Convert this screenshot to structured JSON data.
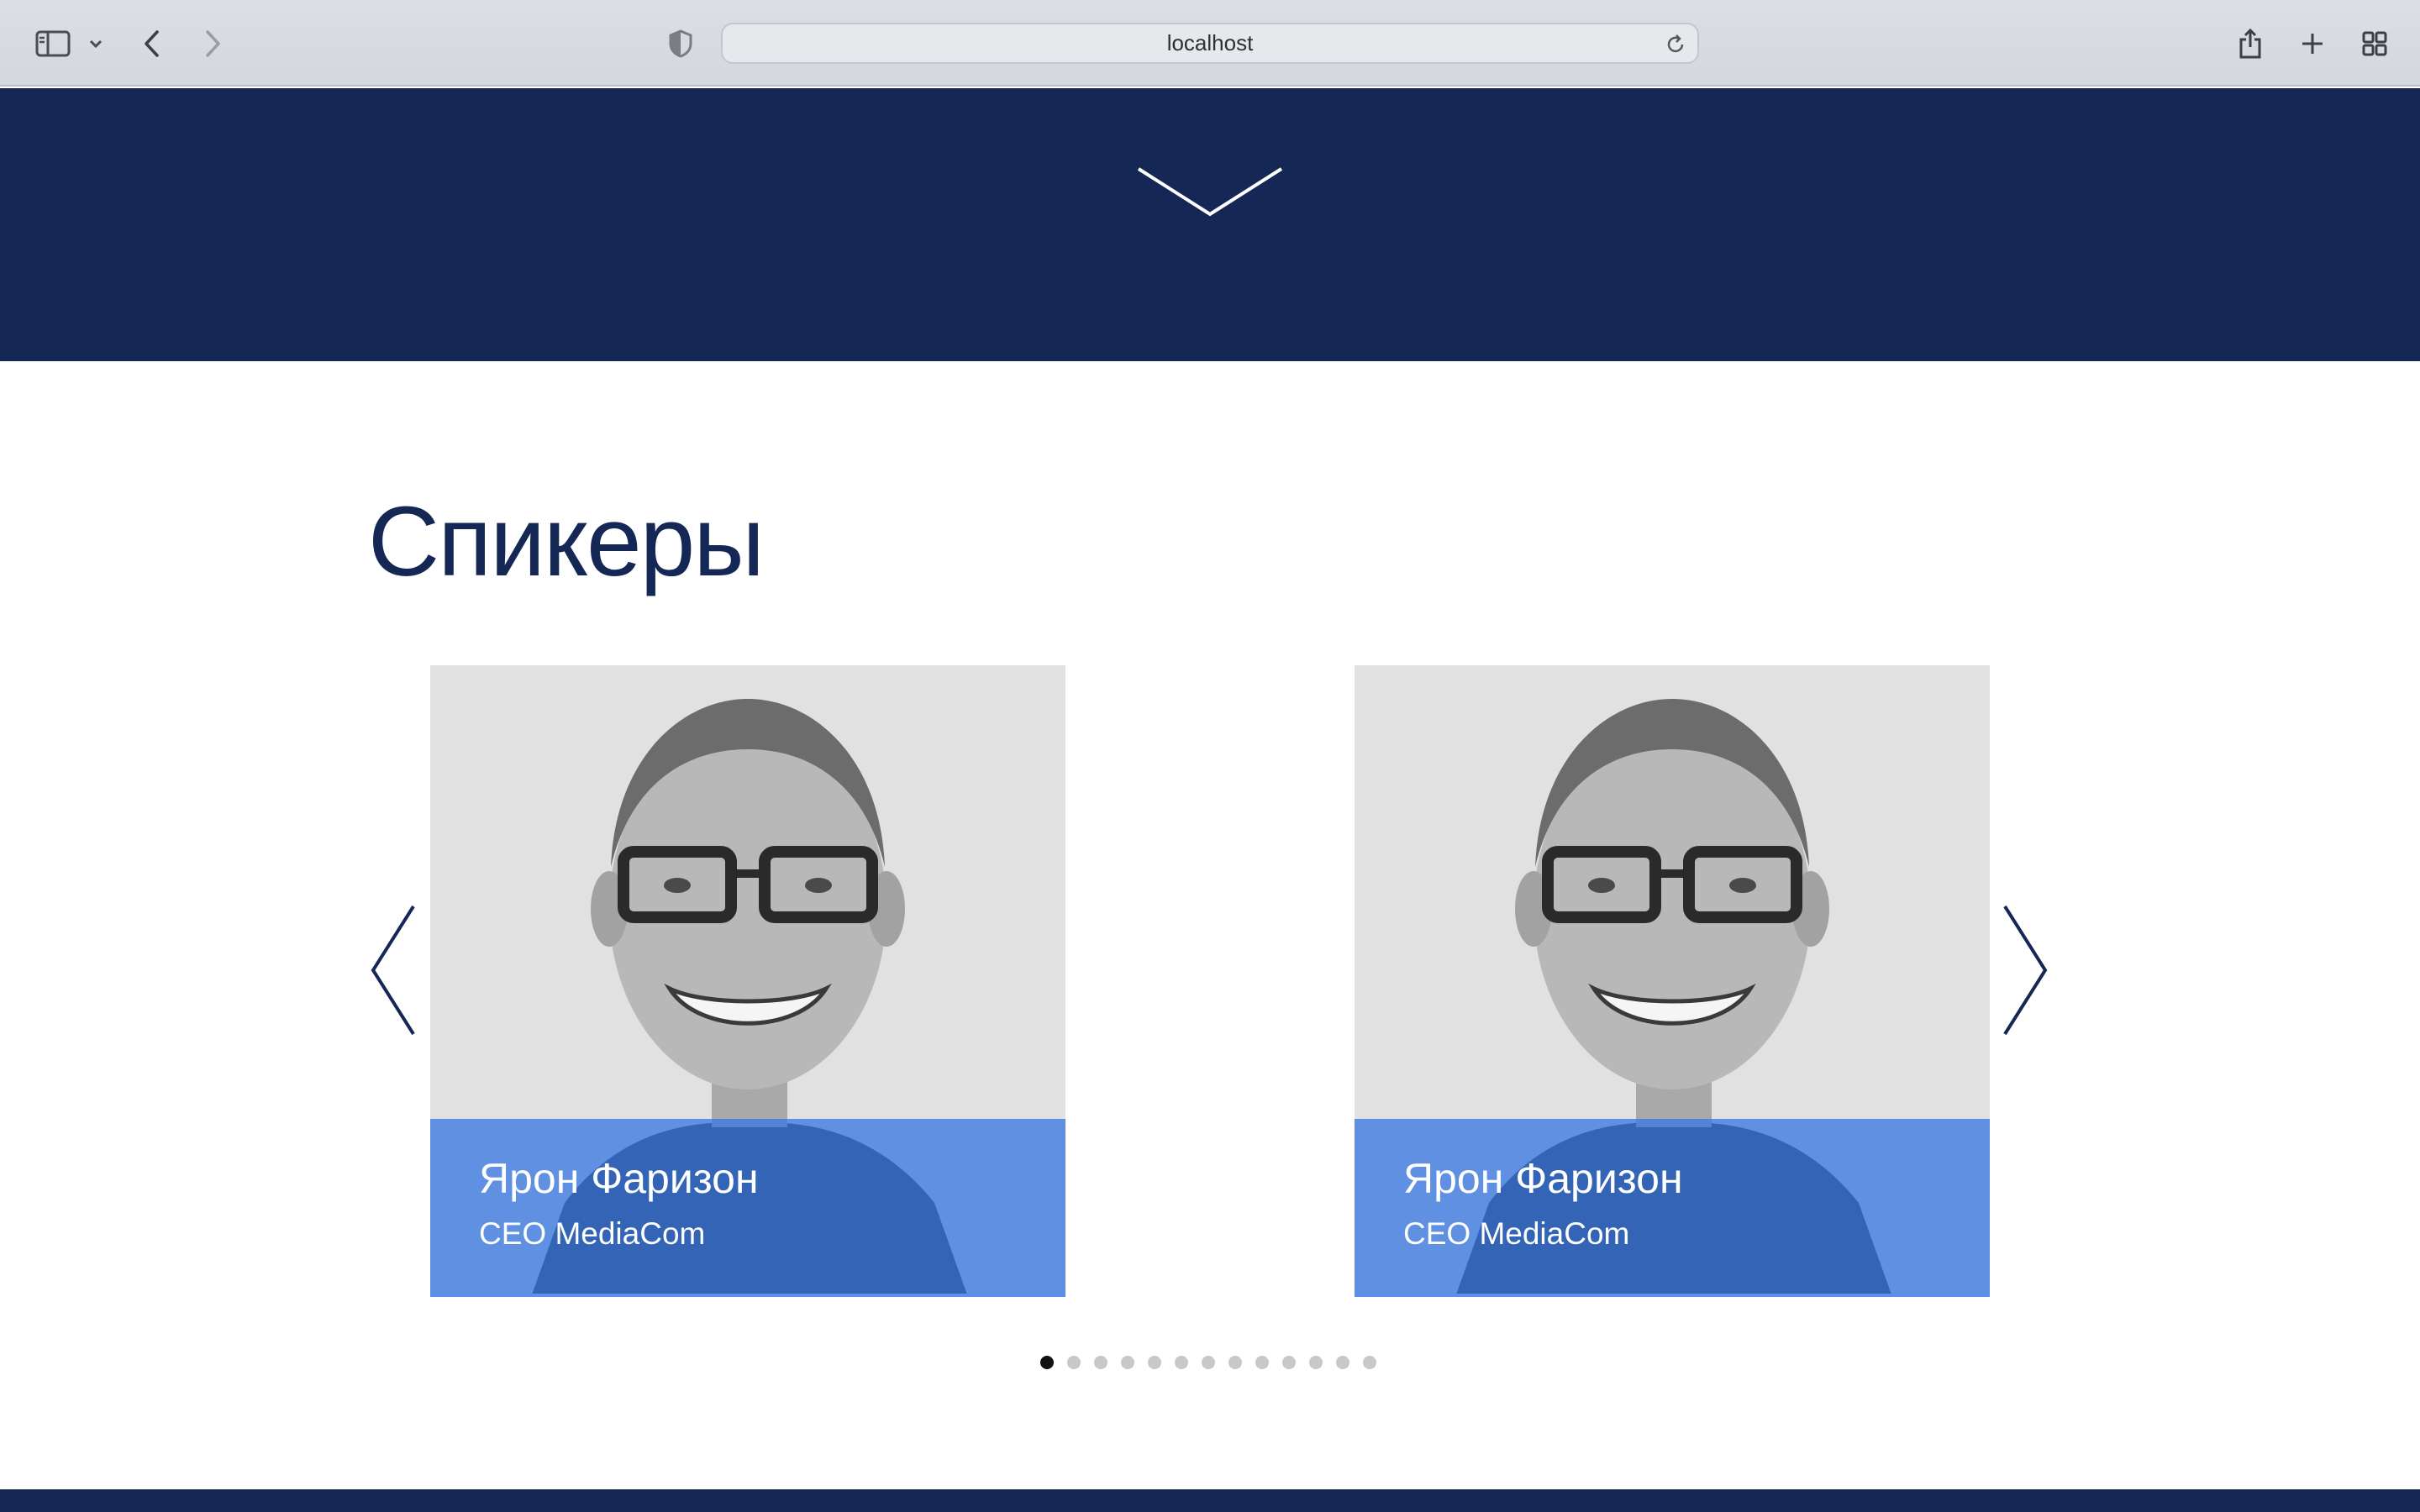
{
  "browser": {
    "url": "localhost",
    "icons": [
      "sidebar-icon",
      "chevron-down-icon",
      "back-icon",
      "forward-icon",
      "shield-icon",
      "reload-icon",
      "share-icon",
      "plus-icon",
      "tab-overview-icon"
    ]
  },
  "hero": {
    "background_color": "#142755",
    "scroll_icon": "chevron-down-icon"
  },
  "speakers": {
    "title": "Спикеры",
    "cards": [
      {
        "name": "Ярон Фаризон",
        "role": "CEO MediaCom"
      },
      {
        "name": "Ярон Фаризон",
        "role": "CEO MediaCom"
      }
    ],
    "pagination": {
      "total": 13,
      "active": 1
    },
    "prev_icon": "chevron-left-icon",
    "next_icon": "chevron-right-icon",
    "accent_color": "#3a78e2"
  }
}
